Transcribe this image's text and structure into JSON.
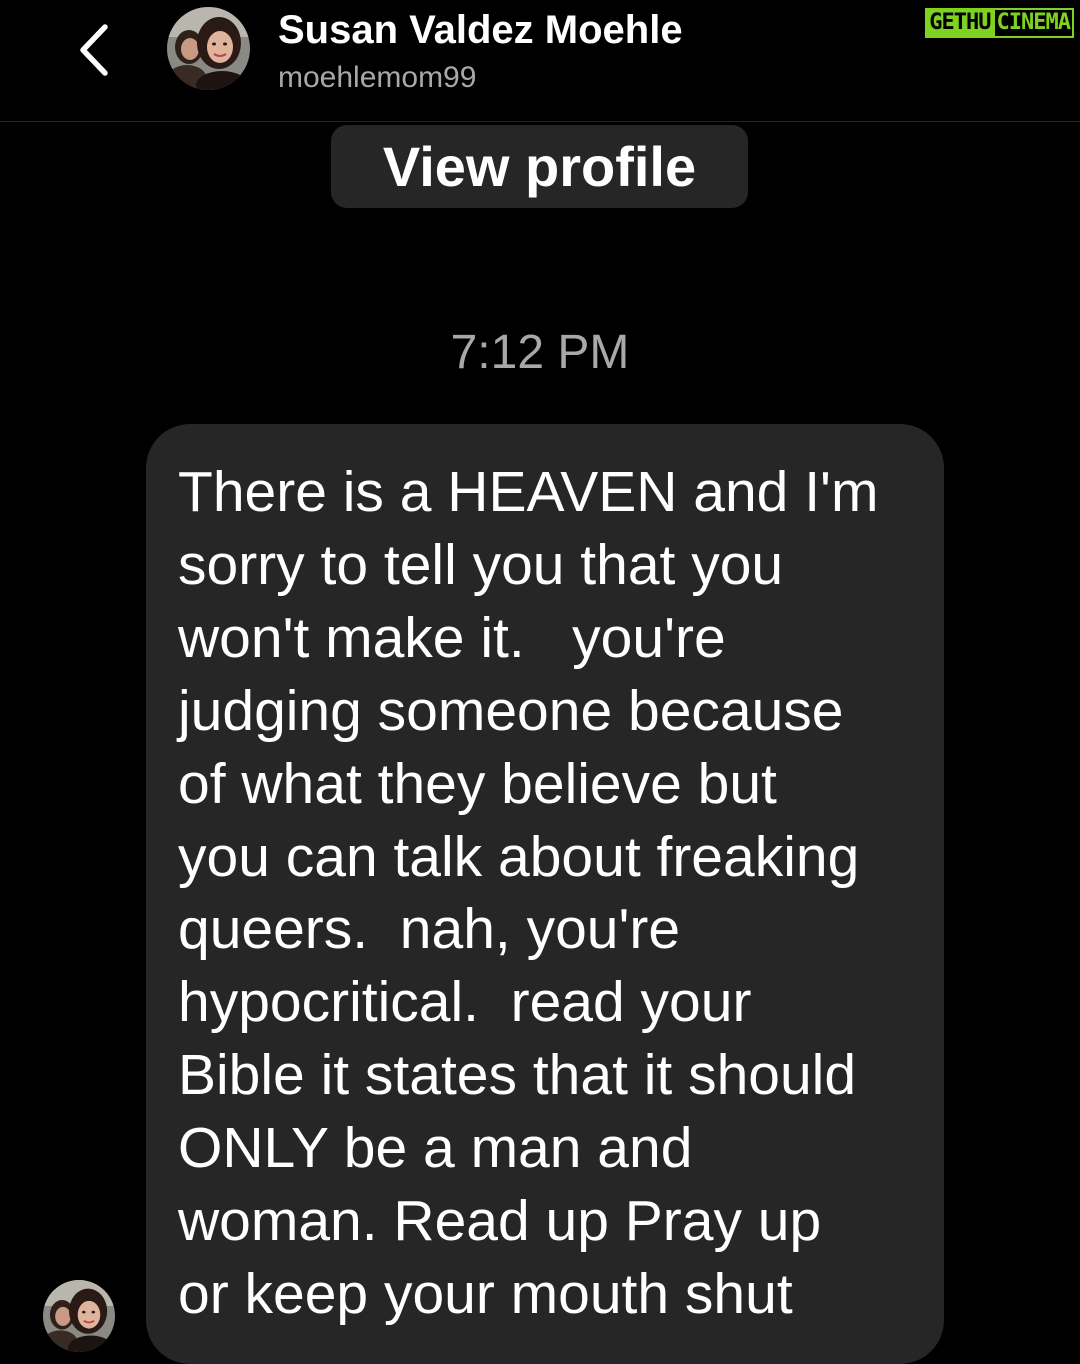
{
  "header": {
    "name": "Susan Valdez Moehle",
    "username": "moehlemom99",
    "back_icon": "chevron-left-icon",
    "avatar": "profile-photo-avatar"
  },
  "watermark": {
    "part1": "GETHU",
    "part2": "CINEMA",
    "accent_color": "#7ed321"
  },
  "view_profile_label": "View profile",
  "timestamp": "7:12 PM",
  "message": {
    "text": "There is a HEAVEN and I'm\nsorry to tell you that you\nwon't make it.   you're\njudging someone because\nof what they believe but\nyou can talk about freaking\nqueers.  nah, you're\nhypocritical.  read your\nBible it states that it should\nONLY be a man and\nwoman. Read up Pray up\nor keep your mouth shut"
  },
  "colors": {
    "background": "#000000",
    "bubble": "#262626",
    "secondary_text": "#a8a8a8"
  }
}
